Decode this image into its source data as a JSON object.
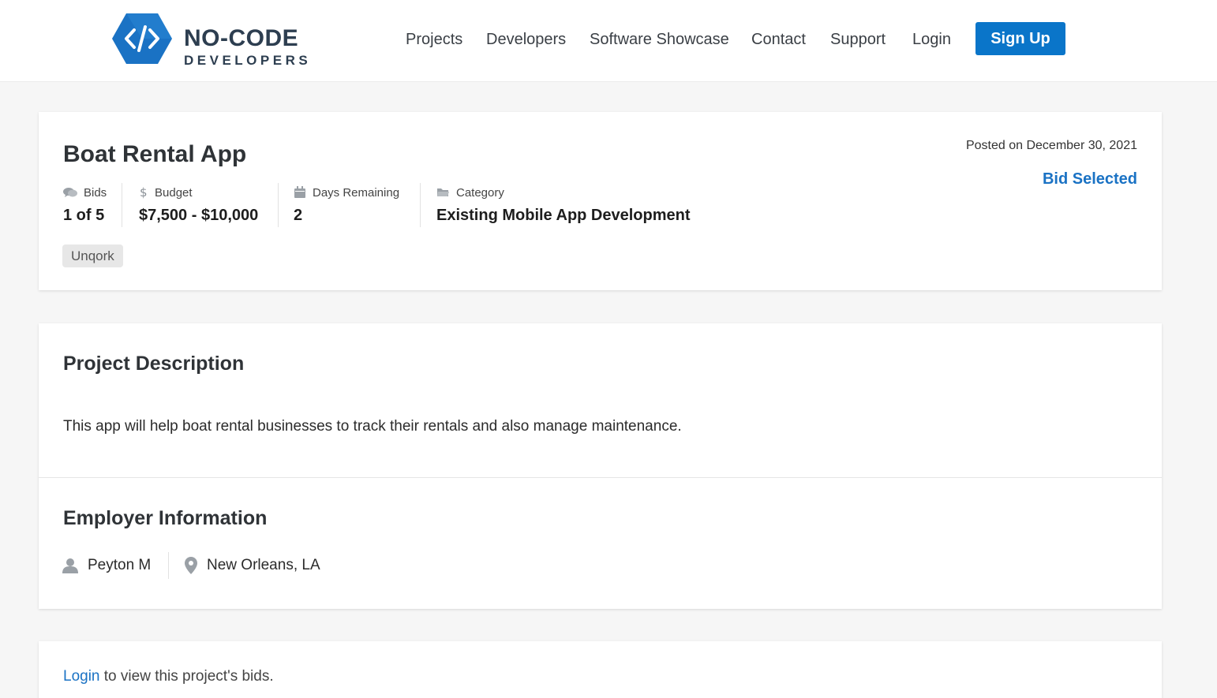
{
  "header": {
    "logo": {
      "line1": "NO-CODE",
      "line2": "DEVELOPERS",
      "brand_color": "#1a72c4"
    },
    "nav": [
      "Projects",
      "Developers",
      "Software Showcase",
      "Contact",
      "Support",
      "Login"
    ],
    "signup_label": "Sign Up"
  },
  "project": {
    "title": "Boat Rental App",
    "posted": "Posted on December 30, 2021",
    "status": "Bid Selected",
    "stats": {
      "bids": {
        "label": "Bids",
        "value": "1 of 5",
        "icon": "comments-icon"
      },
      "budget": {
        "label": "Budget",
        "value": "$7,500 - $10,000",
        "icon": "dollar-icon"
      },
      "days": {
        "label": "Days Remaining",
        "value": "2",
        "icon": "calendar-icon"
      },
      "category": {
        "label": "Category",
        "value": "Existing Mobile App Development",
        "icon": "folder-icon"
      }
    },
    "tag": "Unqork"
  },
  "description": {
    "heading": "Project Description",
    "text": "This app will help boat rental businesses to track their rentals and also manage maintenance."
  },
  "employer": {
    "heading": "Employer Information",
    "name": "Peyton M",
    "location": "New Orleans, LA"
  },
  "bids_notice": {
    "link": "Login",
    "text": " to view this project's bids."
  },
  "colors": {
    "accent": "#0a75c9",
    "link": "#1a72c4",
    "background": "#f6f6f6"
  }
}
